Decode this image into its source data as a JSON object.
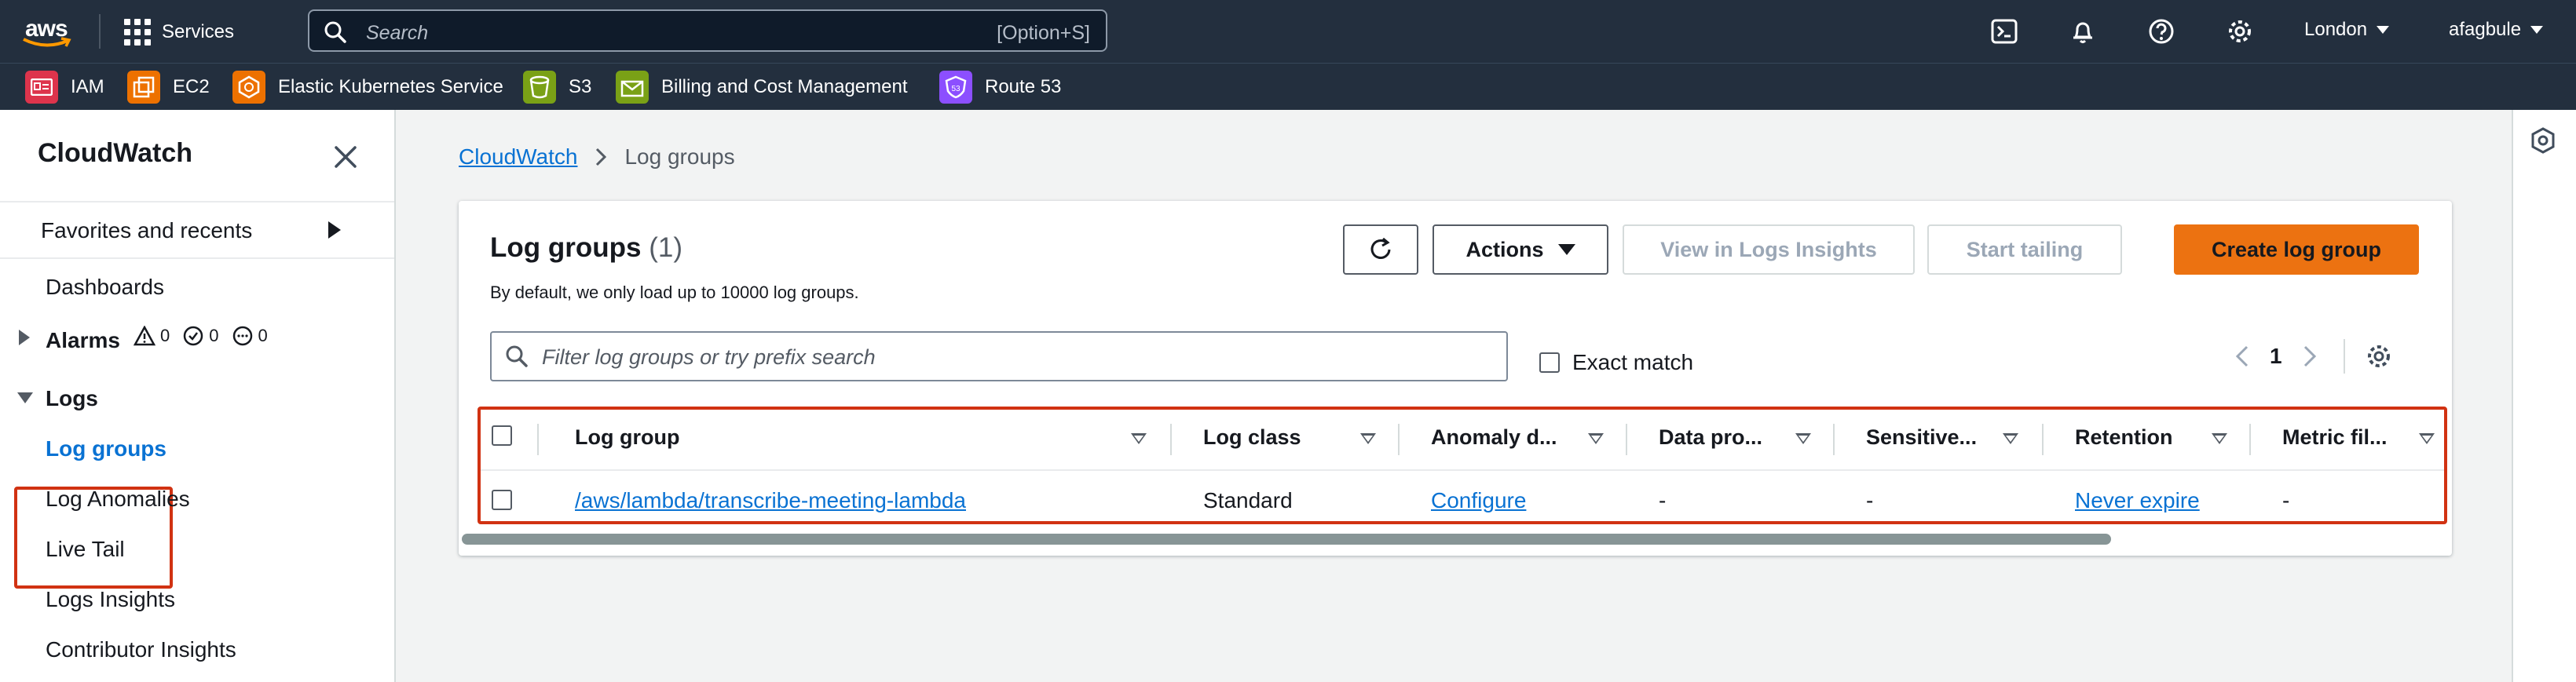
{
  "topnav": {
    "logo_text": "aws",
    "services_label": "Services",
    "search_placeholder": "Search",
    "search_shortcut": "[Option+S]",
    "region": "London",
    "user": "afagbule"
  },
  "favorites": [
    {
      "label": "IAM",
      "color": "#dd344c"
    },
    {
      "label": "EC2",
      "color": "#ed7100"
    },
    {
      "label": "Elastic Kubernetes Service",
      "color": "#ed7100"
    },
    {
      "label": "S3",
      "color": "#7aa116"
    },
    {
      "label": "Billing and Cost Management",
      "color": "#7aa116"
    },
    {
      "label": "Route 53",
      "color": "#8c4fff"
    }
  ],
  "sidebar": {
    "title": "CloudWatch",
    "favorites_label": "Favorites and recents",
    "dashboards": "Dashboards",
    "alarms": "Alarms",
    "alarm_counts": [
      "0",
      "0",
      "0"
    ],
    "logs": "Logs",
    "log_groups": "Log groups",
    "log_anomalies": "Log Anomalies",
    "live_tail": "Live Tail",
    "logs_insights": "Logs Insights",
    "contributor_insights": "Contributor Insights"
  },
  "breadcrumb": {
    "root": "CloudWatch",
    "current": "Log groups"
  },
  "panel": {
    "title": "Log groups",
    "count": "(1)",
    "subtitle": "By default, we only load up to 10000 log groups.",
    "actions_label": "Actions",
    "view_insights_label": "View in Logs Insights",
    "start_tailing_label": "Start tailing",
    "create_label": "Create log group",
    "filter_placeholder": "Filter log groups or try prefix search",
    "exact_match_label": "Exact match",
    "page_number": "1"
  },
  "table": {
    "columns": [
      "Log group",
      "Log class",
      "Anomaly d...",
      "Data pro...",
      "Sensitive...",
      "Retention",
      "Metric fil..."
    ],
    "rows": [
      {
        "log_group": "/aws/lambda/transcribe-meeting-lambda",
        "log_class": "Standard",
        "anomaly": "Configure",
        "data_protection": "-",
        "sensitive": "-",
        "retention": "Never expire",
        "metric_filters": "-"
      }
    ]
  },
  "colors": {
    "nav_bg": "#232f3e",
    "primary_button": "#ec7211",
    "link": "#0972d3",
    "highlight": "#d13212"
  },
  "ui": {
    "table_scroll_fraction": 0.83
  }
}
